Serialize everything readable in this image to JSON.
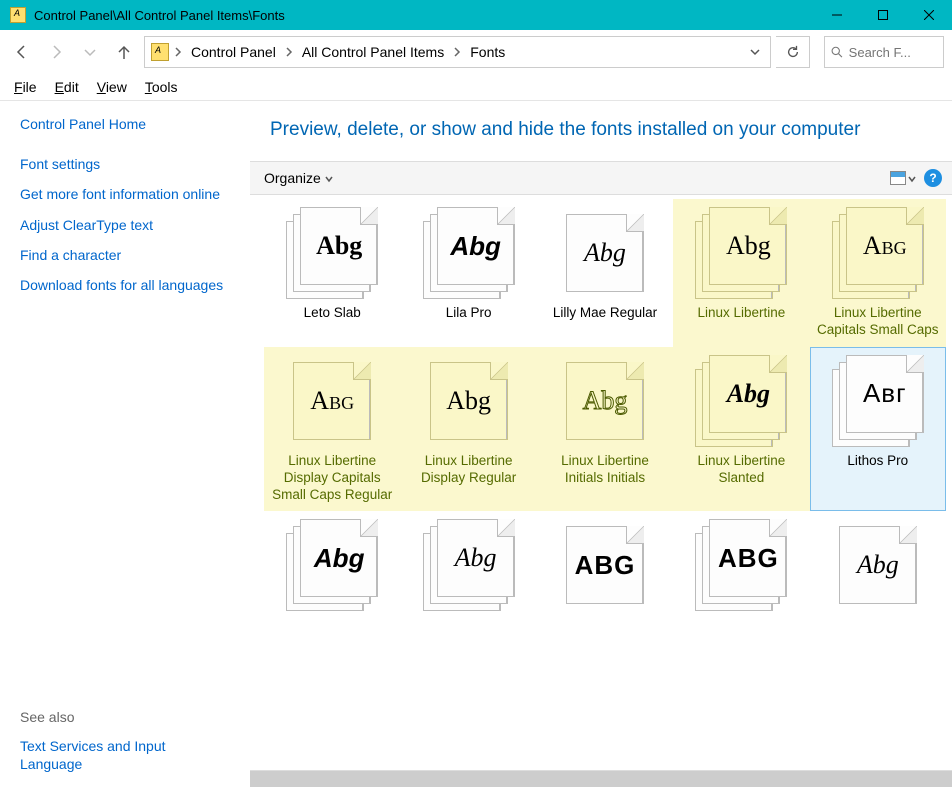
{
  "window": {
    "title": "Control Panel\\All Control Panel Items\\Fonts"
  },
  "breadcrumb": {
    "items": [
      "Control Panel",
      "All Control Panel Items",
      "Fonts"
    ]
  },
  "search": {
    "placeholder": "Search F..."
  },
  "menus": {
    "file": "File",
    "edit": "Edit",
    "view": "View",
    "tools": "Tools"
  },
  "sidebar": {
    "home": "Control Panel Home",
    "links": [
      "Font settings",
      "Get more font information online",
      "Adjust ClearType text",
      "Find a character",
      "Download fonts for all languages"
    ],
    "see_also_label": "See also",
    "see_also_links": [
      "Text Services and Input Language"
    ]
  },
  "main": {
    "heading": "Preview, delete, or show and hide the fonts installed on your computer",
    "toolbar": {
      "organize": "Organize"
    }
  },
  "fonts": {
    "row1": [
      {
        "name": "Leto Slab",
        "sample": "Abg",
        "stack": true,
        "new": false,
        "cls": "f-slabb"
      },
      {
        "name": "Lila Pro",
        "sample": "Abg",
        "stack": true,
        "new": false,
        "cls": "f-roundb"
      },
      {
        "name": "Lilly Mae Regular",
        "sample": "Abg",
        "stack": false,
        "new": false,
        "cls": "f-script"
      },
      {
        "name": "Linux Libertine",
        "sample": "Abg",
        "stack": true,
        "new": true,
        "cls": "f-serif"
      },
      {
        "name": "Linux Libertine Capitals Small Caps",
        "sample": "Abg",
        "stack": true,
        "new": true,
        "cls": "f-serif smcap"
      }
    ],
    "row2": [
      {
        "name": "Linux Libertine Display Capitals Small Caps Regular",
        "sample": "Abg",
        "stack": false,
        "new": true,
        "cls": "f-serif smcap"
      },
      {
        "name": "Linux Libertine Display Regular",
        "sample": "Abg",
        "stack": false,
        "new": true,
        "cls": "f-serif"
      },
      {
        "name": "Linux Libertine Initials Initials",
        "sample": "Abg",
        "stack": false,
        "new": true,
        "cls": "f-serif f-outline"
      },
      {
        "name": "Linux Libertine Slanted",
        "sample": "Abg",
        "stack": true,
        "new": true,
        "cls": "f-serif f-slanti"
      },
      {
        "name": "Lithos Pro",
        "sample": "Aвг",
        "stack": true,
        "new": false,
        "cls": "f-lithos",
        "selected": true
      }
    ],
    "row3": [
      {
        "name": "",
        "sample": "Abg",
        "stack": true,
        "new": false,
        "cls": "f-blackit"
      },
      {
        "name": "",
        "sample": "Abg",
        "stack": true,
        "new": false,
        "cls": "f-script"
      },
      {
        "name": "",
        "sample": "ABG",
        "stack": false,
        "new": false,
        "cls": "f-blocky"
      },
      {
        "name": "",
        "sample": "ABG",
        "stack": true,
        "new": false,
        "cls": "f-blocky"
      },
      {
        "name": "",
        "sample": "Abg",
        "stack": false,
        "new": false,
        "cls": "f-script"
      }
    ]
  }
}
